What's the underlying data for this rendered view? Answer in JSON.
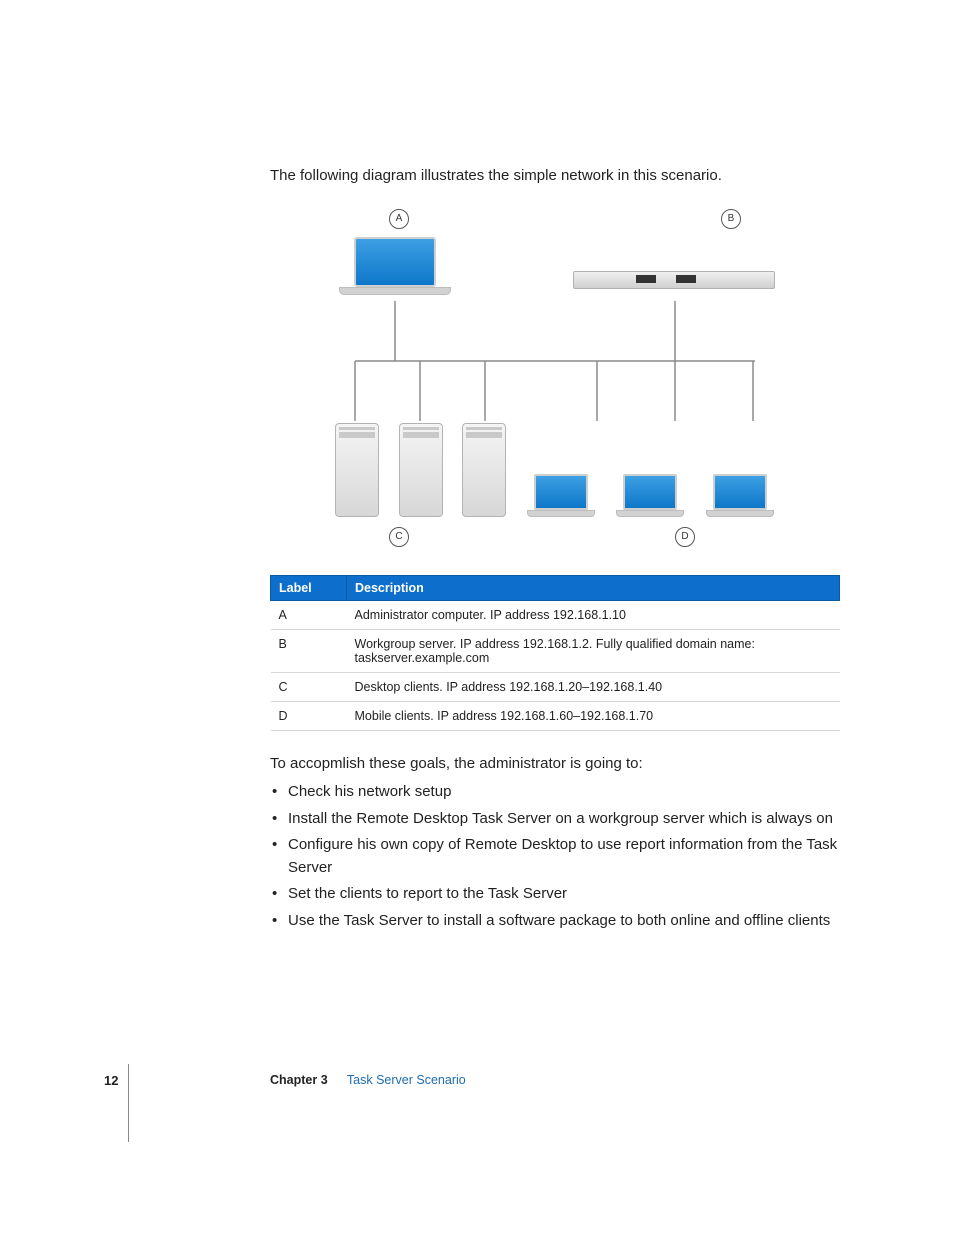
{
  "intro": "The following diagram illustrates the simple network in this scenario.",
  "diagram": {
    "labels": {
      "a": "A",
      "b": "B",
      "c": "C",
      "d": "D"
    }
  },
  "table": {
    "headers": {
      "label": "Label",
      "description": "Description"
    },
    "rows": [
      {
        "label": "A",
        "description": "Administrator computer. IP address 192.168.1.10"
      },
      {
        "label": "B",
        "description": "Workgroup server. IP address 192.168.1.2. Fully qualified domain name: taskserver.example.com"
      },
      {
        "label": "C",
        "description": "Desktop clients. IP address 192.168.1.20–192.168.1.40"
      },
      {
        "label": "D",
        "description": "Mobile clients. IP address 192.168.1.60–192.168.1.70"
      }
    ]
  },
  "lead": "To accopmlish these goals, the administrator is going to:",
  "goals": [
    "Check his network setup",
    "Install the Remote Desktop Task Server on a workgroup server which is always on",
    "Configure his own copy of Remote Desktop to use report information from the Task Server",
    "Set the clients to report to the Task Server",
    "Use the Task Server to install a software package to both online and offline clients"
  ],
  "footer": {
    "page": "12",
    "chapter": "Chapter 3",
    "title": "Task Server Scenario"
  }
}
